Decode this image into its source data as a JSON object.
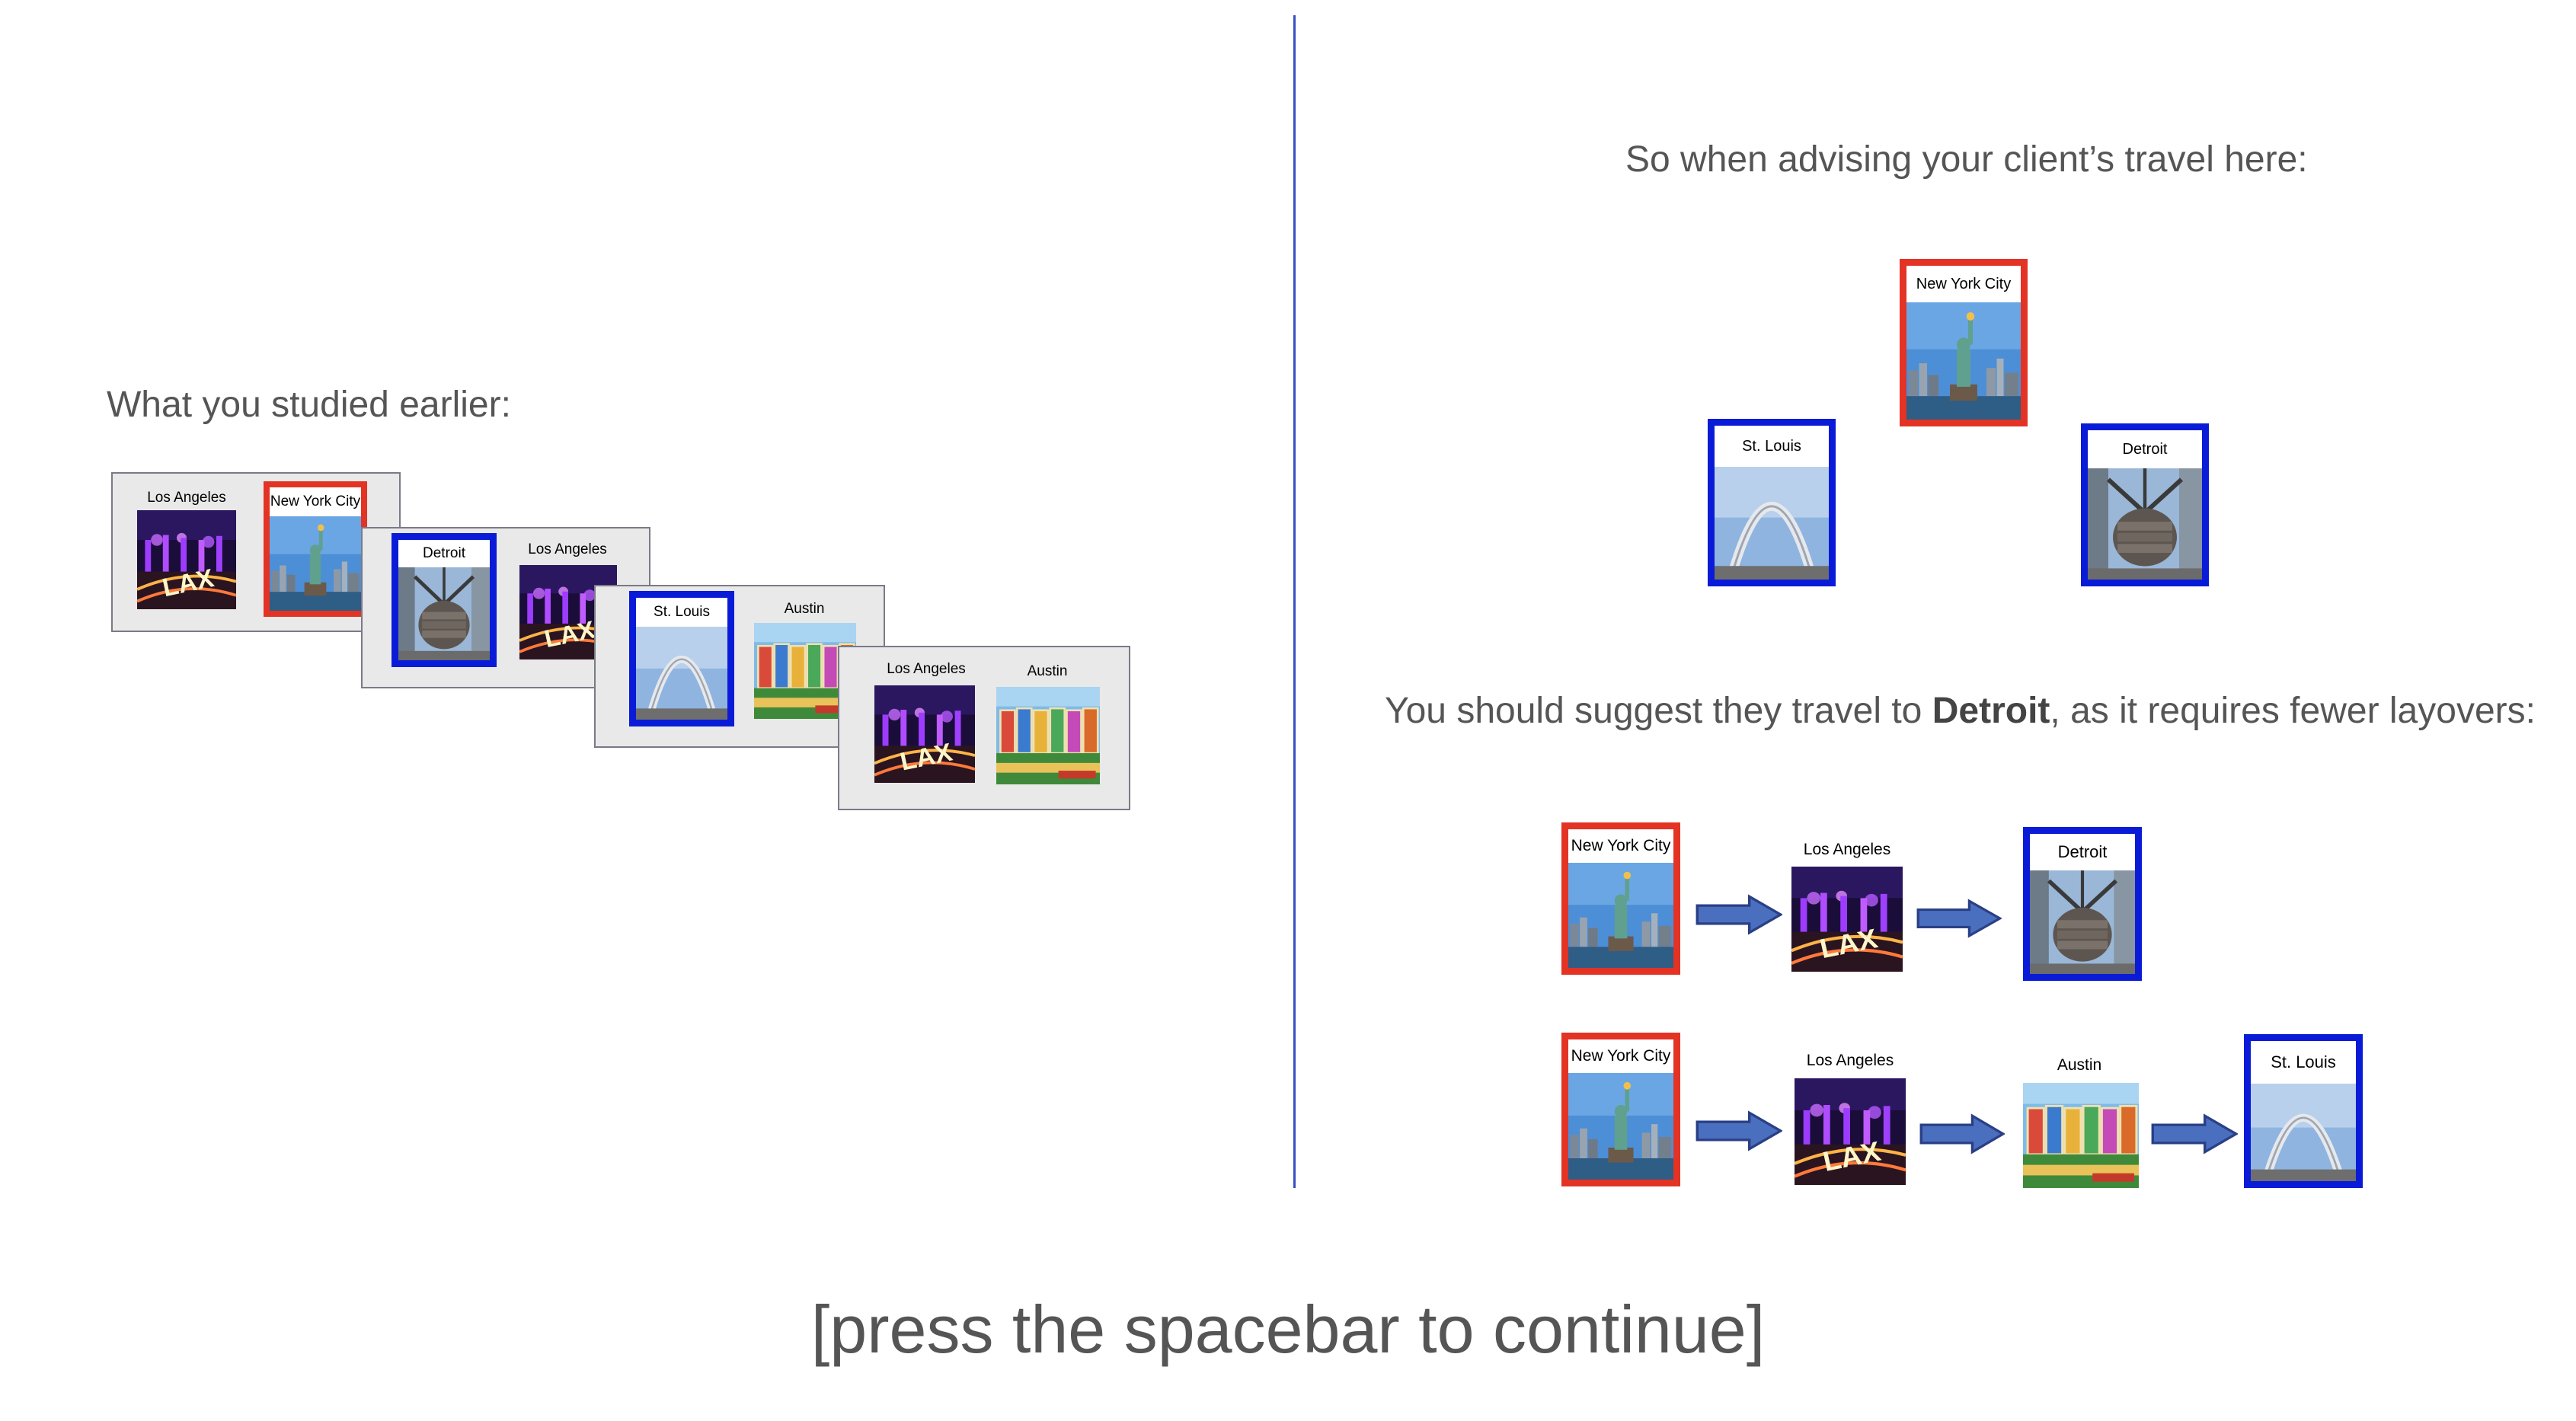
{
  "left": {
    "heading": "What you studied earlier:",
    "panels": [
      {
        "cities": [
          "Los Angeles",
          "New York City"
        ],
        "highlight": [
          null,
          "red"
        ]
      },
      {
        "cities": [
          "Detroit",
          "Los Angeles"
        ],
        "highlight": [
          "blue",
          null
        ]
      },
      {
        "cities": [
          "St. Louis",
          "Austin"
        ],
        "highlight": [
          "blue",
          null
        ]
      },
      {
        "cities": [
          "Los Angeles",
          "Austin"
        ],
        "highlight": [
          null,
          null
        ]
      }
    ]
  },
  "right": {
    "heading": "So when advising your client’s travel here:",
    "options": {
      "start": "New York City",
      "choice_a": "St. Louis",
      "choice_b": "Detroit"
    },
    "suggestion": {
      "prefix": "You should suggest they travel to ",
      "answer": "Detroit",
      "suffix": ", as it requires fewer layovers:"
    },
    "route_1": [
      "New York City",
      "Los Angeles",
      "Detroit"
    ],
    "route_2": [
      "New York City",
      "Los Angeles",
      "Austin",
      "St. Louis"
    ]
  },
  "footer": {
    "prompt": "[press the spacebar to continue]"
  },
  "colors": {
    "start_border": "#e33325",
    "choice_border": "#0a1bd8",
    "divider": "#3a4fc4",
    "arrow_fill": "#4a6fbf",
    "arrow_stroke": "#2a3f85",
    "text": "#555555"
  },
  "icons": {
    "Los Angeles": "lax-night-photo-icon",
    "New York City": "statue-of-liberty-photo-icon",
    "Detroit": "joe-louis-fist-photo-icon",
    "St. Louis": "gateway-arch-photo-icon",
    "Austin": "greetings-from-austin-postcard-icon"
  }
}
